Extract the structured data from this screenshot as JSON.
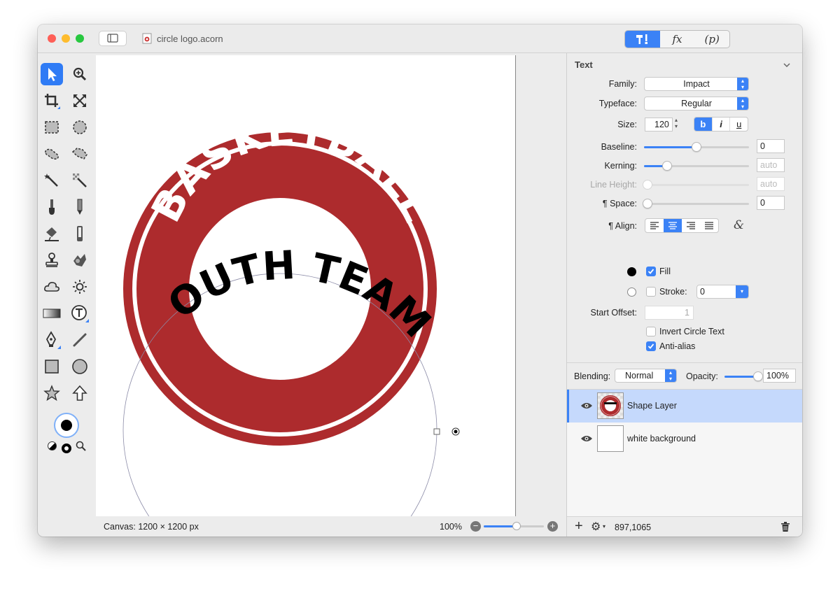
{
  "window": {
    "title": "circle logo.acorn",
    "traffic_light_colors": [
      "#fe5f57",
      "#febc2e",
      "#28c840"
    ],
    "accent_color": "#3b82f6"
  },
  "toolbar": {
    "inspector_tabs": [
      "tools-icon",
      "fx",
      "(p)"
    ],
    "fx_label": "fx",
    "p_label": "(p)"
  },
  "tools": [
    "select-arrow",
    "zoom",
    "crop",
    "transform",
    "rect-select",
    "ellipse-select",
    "lasso",
    "polygon-lasso",
    "magic-wand",
    "magic-eraser",
    "brush",
    "pencil",
    "paint-bucket",
    "eraser",
    "clone-stamp",
    "smudge",
    "cloud",
    "sun",
    "gradient",
    "text",
    "pen",
    "line",
    "rectangle",
    "ellipse",
    "star",
    "arrow"
  ],
  "canvas": {
    "logo_arc_text": "BASKETBALL",
    "logo_curved_text": "YOUTH TEAM",
    "logo_red": "#ad2b2d"
  },
  "status": {
    "canvas_size": "Canvas: 1200 × 1200 px",
    "zoom": "100%",
    "zoom_level": 0.55,
    "coordinates": "897,1065"
  },
  "inspector": {
    "section_title": "Text",
    "family_label": "Family:",
    "family_value": "Impact",
    "typeface_label": "Typeface:",
    "typeface_value": "Regular",
    "size_label": "Size:",
    "size_value": "120",
    "style_buttons": [
      "b",
      "i",
      "u"
    ],
    "baseline_label": "Baseline:",
    "baseline_value": "0",
    "baseline_level": 0.5,
    "kerning_label": "Kerning:",
    "kerning_value": "auto",
    "kerning_level": 0.22,
    "line_height_label": "Line Height:",
    "line_height_value": "auto",
    "space_label": "¶ Space:",
    "space_value": "0",
    "align_label": "¶ Align:",
    "fill_label": "Fill",
    "fill_checked": true,
    "fill_color": "#000000",
    "stroke_label": "Stroke:",
    "stroke_checked": false,
    "stroke_value": "0",
    "start_offset_label": "Start Offset:",
    "start_offset_value": "1",
    "invert_label": "Invert Circle Text",
    "invert_checked": false,
    "antialias_label": "Anti-alias",
    "antialias_checked": true
  },
  "blending": {
    "blending_label": "Blending:",
    "blending_value": "Normal",
    "opacity_label": "Opacity:",
    "opacity_value": "100%",
    "opacity_level": 1.0
  },
  "layers": [
    {
      "name": "Shape Layer",
      "selected": true
    },
    {
      "name": "white background",
      "selected": false
    }
  ]
}
